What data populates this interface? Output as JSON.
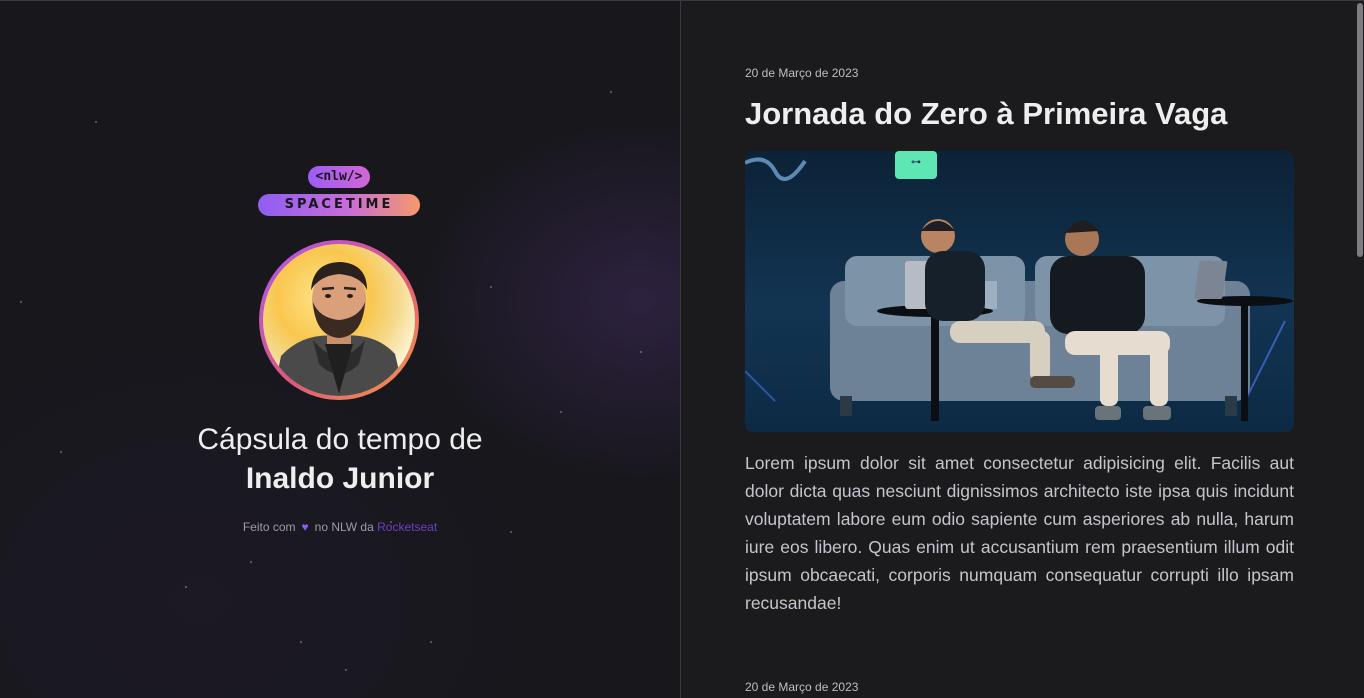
{
  "left": {
    "logo": {
      "top": "<nlw/>",
      "bottom": "SPACETIME"
    },
    "avatar_icon": "user-photo",
    "title_line": "Cápsula do tempo de",
    "user_name": "Inaldo Junior",
    "footer": {
      "prefix": "Feito com",
      "heart": "♥",
      "middle": "no NLW da",
      "link": "Rocketseat"
    }
  },
  "memories": [
    {
      "date": "20 de Março de 2023",
      "title": "Jornada do Zero à Primeira Vaga",
      "image": "stage-photo-two-speakers-on-couch",
      "text": "Lorem ipsum dolor sit amet consectetur adipisicing elit. Facilis aut dolor dicta quas nesciunt dignissimos architecto iste ipsa quis incidunt voluptatem labore eum odio sapiente cum asperiores ab nulla, harum iure eos libero. Quas enim ut accusantium rem praesentium illum odit ipsum obcaecati, corporis numquam consequatur corrupti illo ipsam recusandae!"
    },
    {
      "date": "20 de Março de 2023"
    }
  ],
  "colors": {
    "accent_purple": "#8b5cf6",
    "link_purple": "#6d3fc9",
    "left_bg": "#18171c",
    "right_bg": "#1b1b1e"
  }
}
